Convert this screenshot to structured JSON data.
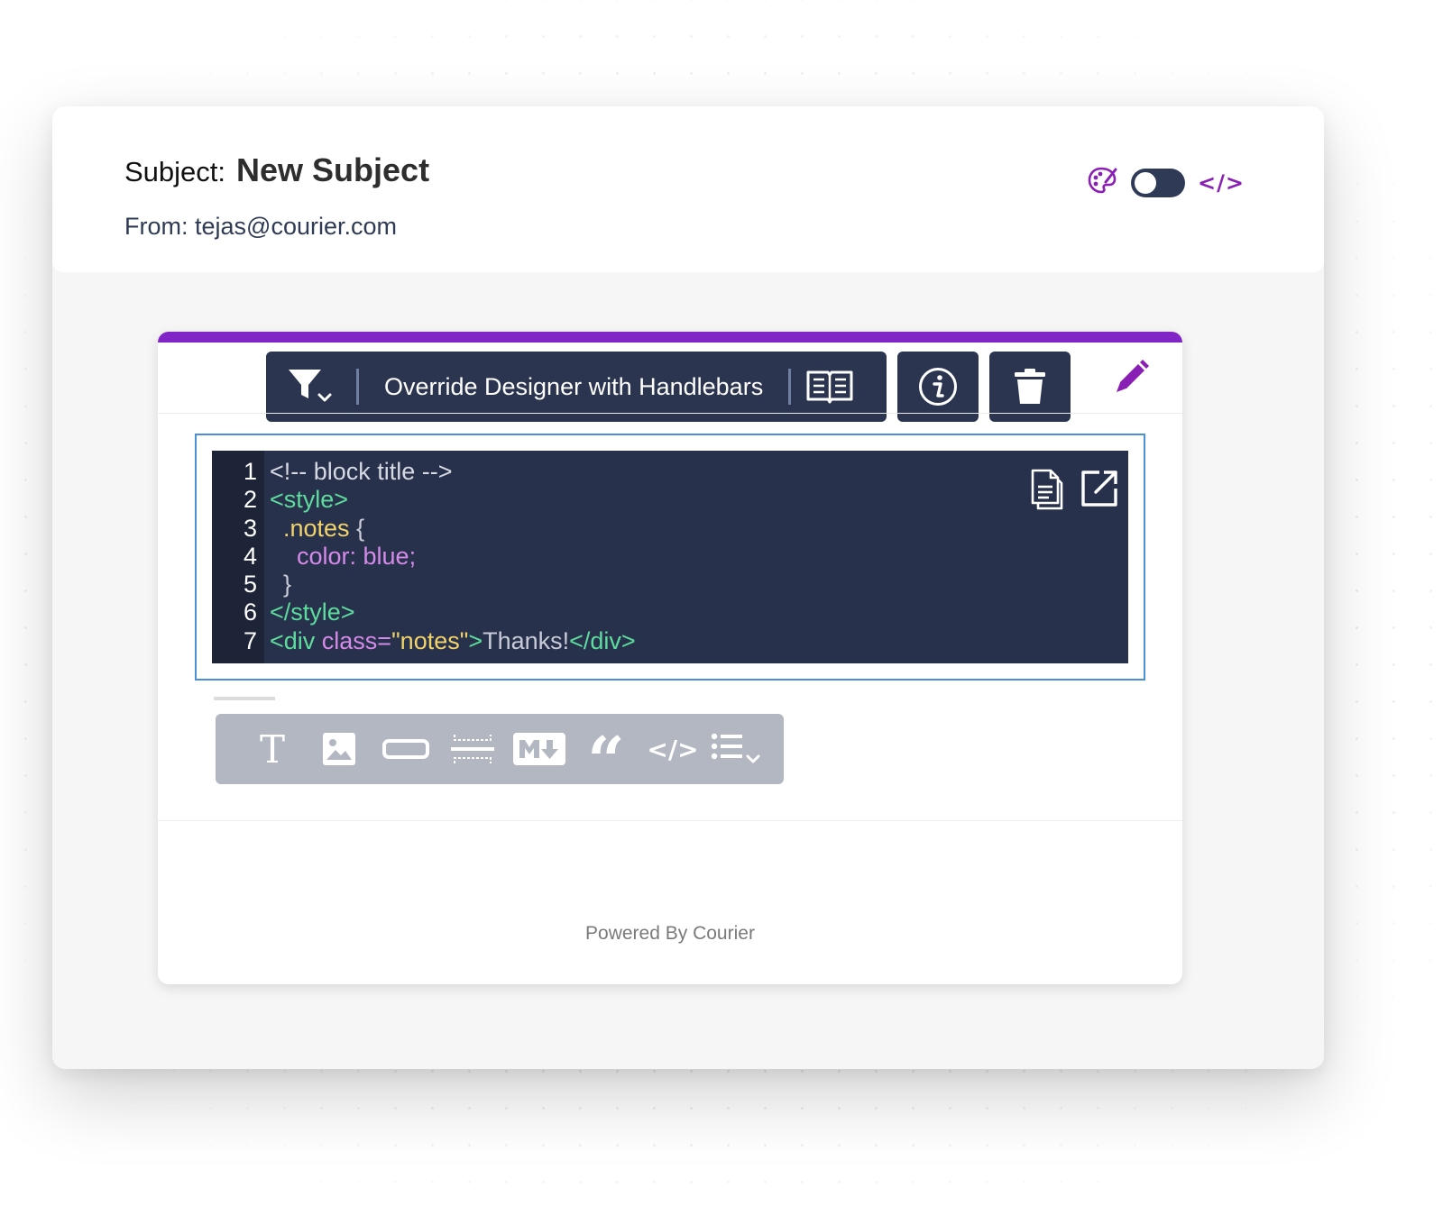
{
  "header": {
    "subject_label": "Subject:",
    "subject_value": "New Subject",
    "from_label": "From:",
    "from_value": "tejas@courier.com",
    "code_toggle_label": "</>"
  },
  "toolbar": {
    "title": "Override Designer with Handlebars"
  },
  "code": {
    "line_numbers": [
      "1",
      "2",
      "3",
      "4",
      "5",
      "6",
      "7"
    ],
    "lines": {
      "l1": "<!-- block title -->",
      "l2": "<style>",
      "l3_cls": "  .notes",
      "l3_rest": " {",
      "l4_prop": "    color: blue;",
      "l5": "  }",
      "l6": "</style>",
      "l7_open": "<div ",
      "l7_attr": "class=",
      "l7_str": "\"notes\"",
      "l7_close": ">",
      "l7_text": "Thanks!",
      "l7_end": "</div>"
    }
  },
  "blocks": {
    "text_glyph": "T",
    "quote_glyph": "“",
    "code_glyph": "</>"
  },
  "footer": {
    "powered_by": "Powered By Courier"
  },
  "colors": {
    "accent": "#8125c7",
    "toolbar_bg": "#2b3550",
    "code_bg": "#28314b",
    "block_bar_bg": "#b3b7c2"
  }
}
